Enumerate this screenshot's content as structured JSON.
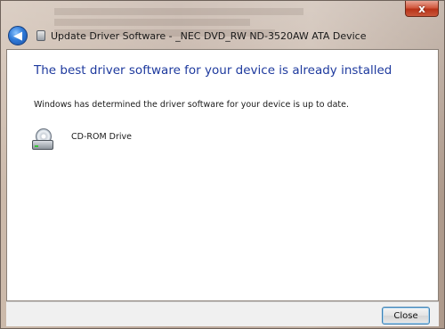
{
  "window": {
    "title": "Update Driver Software - _NEC DVD_RW ND-3520AW ATA Device",
    "close_glyph": "x"
  },
  "nav": {
    "back_glyph": "◀"
  },
  "main": {
    "heading": "The best driver software for your device is already installed",
    "message": "Windows has determined the driver software for your device is up to date.",
    "device": {
      "label": "CD-ROM Drive",
      "icon": "cd-rom-drive-icon"
    }
  },
  "footer": {
    "close_label": "Close"
  },
  "colors": {
    "heading": "#1e3a9e",
    "close_x": "#c9563a",
    "back_button": "#2f7ad8"
  }
}
